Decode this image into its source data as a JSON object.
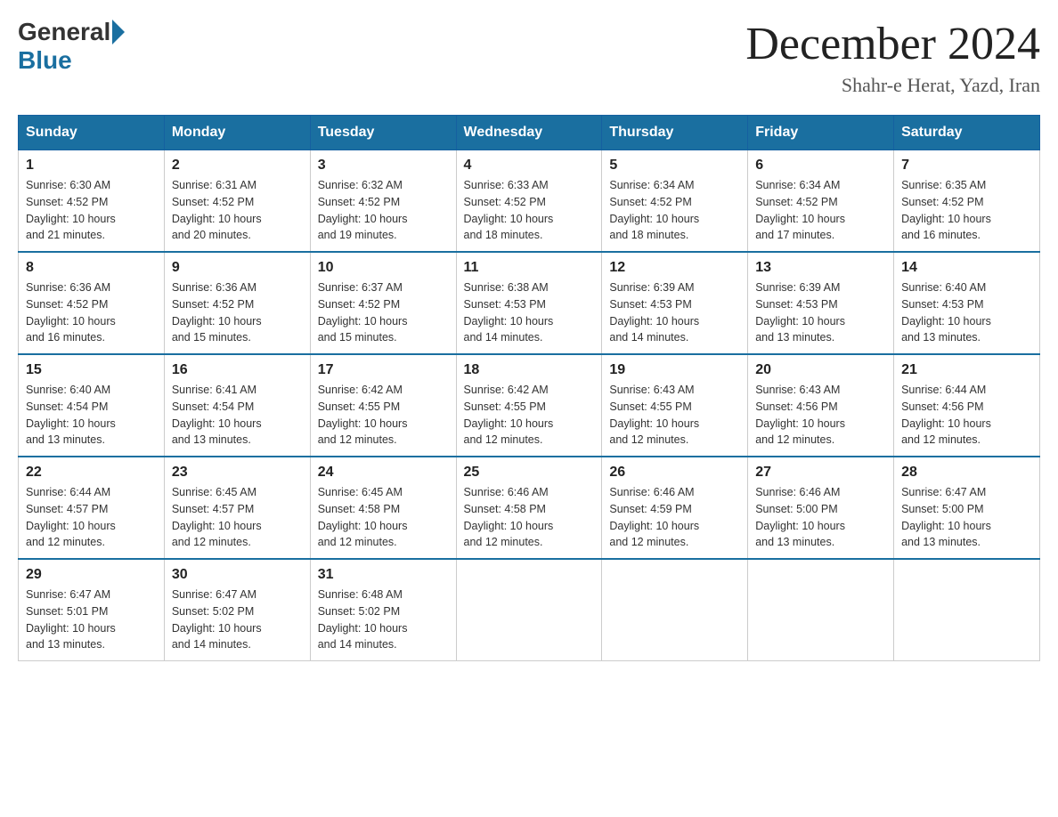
{
  "header": {
    "logo": {
      "general": "General",
      "blue": "Blue"
    },
    "title": "December 2024",
    "subtitle": "Shahr-e Herat, Yazd, Iran"
  },
  "calendar": {
    "days_of_week": [
      "Sunday",
      "Monday",
      "Tuesday",
      "Wednesday",
      "Thursday",
      "Friday",
      "Saturday"
    ],
    "weeks": [
      [
        {
          "day": "1",
          "sunrise": "6:30 AM",
          "sunset": "4:52 PM",
          "daylight": "10 hours and 21 minutes."
        },
        {
          "day": "2",
          "sunrise": "6:31 AM",
          "sunset": "4:52 PM",
          "daylight": "10 hours and 20 minutes."
        },
        {
          "day": "3",
          "sunrise": "6:32 AM",
          "sunset": "4:52 PM",
          "daylight": "10 hours and 19 minutes."
        },
        {
          "day": "4",
          "sunrise": "6:33 AM",
          "sunset": "4:52 PM",
          "daylight": "10 hours and 18 minutes."
        },
        {
          "day": "5",
          "sunrise": "6:34 AM",
          "sunset": "4:52 PM",
          "daylight": "10 hours and 18 minutes."
        },
        {
          "day": "6",
          "sunrise": "6:34 AM",
          "sunset": "4:52 PM",
          "daylight": "10 hours and 17 minutes."
        },
        {
          "day": "7",
          "sunrise": "6:35 AM",
          "sunset": "4:52 PM",
          "daylight": "10 hours and 16 minutes."
        }
      ],
      [
        {
          "day": "8",
          "sunrise": "6:36 AM",
          "sunset": "4:52 PM",
          "daylight": "10 hours and 16 minutes."
        },
        {
          "day": "9",
          "sunrise": "6:36 AM",
          "sunset": "4:52 PM",
          "daylight": "10 hours and 15 minutes."
        },
        {
          "day": "10",
          "sunrise": "6:37 AM",
          "sunset": "4:52 PM",
          "daylight": "10 hours and 15 minutes."
        },
        {
          "day": "11",
          "sunrise": "6:38 AM",
          "sunset": "4:53 PM",
          "daylight": "10 hours and 14 minutes."
        },
        {
          "day": "12",
          "sunrise": "6:39 AM",
          "sunset": "4:53 PM",
          "daylight": "10 hours and 14 minutes."
        },
        {
          "day": "13",
          "sunrise": "6:39 AM",
          "sunset": "4:53 PM",
          "daylight": "10 hours and 13 minutes."
        },
        {
          "day": "14",
          "sunrise": "6:40 AM",
          "sunset": "4:53 PM",
          "daylight": "10 hours and 13 minutes."
        }
      ],
      [
        {
          "day": "15",
          "sunrise": "6:40 AM",
          "sunset": "4:54 PM",
          "daylight": "10 hours and 13 minutes."
        },
        {
          "day": "16",
          "sunrise": "6:41 AM",
          "sunset": "4:54 PM",
          "daylight": "10 hours and 13 minutes."
        },
        {
          "day": "17",
          "sunrise": "6:42 AM",
          "sunset": "4:55 PM",
          "daylight": "10 hours and 12 minutes."
        },
        {
          "day": "18",
          "sunrise": "6:42 AM",
          "sunset": "4:55 PM",
          "daylight": "10 hours and 12 minutes."
        },
        {
          "day": "19",
          "sunrise": "6:43 AM",
          "sunset": "4:55 PM",
          "daylight": "10 hours and 12 minutes."
        },
        {
          "day": "20",
          "sunrise": "6:43 AM",
          "sunset": "4:56 PM",
          "daylight": "10 hours and 12 minutes."
        },
        {
          "day": "21",
          "sunrise": "6:44 AM",
          "sunset": "4:56 PM",
          "daylight": "10 hours and 12 minutes."
        }
      ],
      [
        {
          "day": "22",
          "sunrise": "6:44 AM",
          "sunset": "4:57 PM",
          "daylight": "10 hours and 12 minutes."
        },
        {
          "day": "23",
          "sunrise": "6:45 AM",
          "sunset": "4:57 PM",
          "daylight": "10 hours and 12 minutes."
        },
        {
          "day": "24",
          "sunrise": "6:45 AM",
          "sunset": "4:58 PM",
          "daylight": "10 hours and 12 minutes."
        },
        {
          "day": "25",
          "sunrise": "6:46 AM",
          "sunset": "4:58 PM",
          "daylight": "10 hours and 12 minutes."
        },
        {
          "day": "26",
          "sunrise": "6:46 AM",
          "sunset": "4:59 PM",
          "daylight": "10 hours and 12 minutes."
        },
        {
          "day": "27",
          "sunrise": "6:46 AM",
          "sunset": "5:00 PM",
          "daylight": "10 hours and 13 minutes."
        },
        {
          "day": "28",
          "sunrise": "6:47 AM",
          "sunset": "5:00 PM",
          "daylight": "10 hours and 13 minutes."
        }
      ],
      [
        {
          "day": "29",
          "sunrise": "6:47 AM",
          "sunset": "5:01 PM",
          "daylight": "10 hours and 13 minutes."
        },
        {
          "day": "30",
          "sunrise": "6:47 AM",
          "sunset": "5:02 PM",
          "daylight": "10 hours and 14 minutes."
        },
        {
          "day": "31",
          "sunrise": "6:48 AM",
          "sunset": "5:02 PM",
          "daylight": "10 hours and 14 minutes."
        },
        null,
        null,
        null,
        null
      ]
    ],
    "labels": {
      "sunrise": "Sunrise:",
      "sunset": "Sunset:",
      "daylight": "Daylight:"
    }
  }
}
